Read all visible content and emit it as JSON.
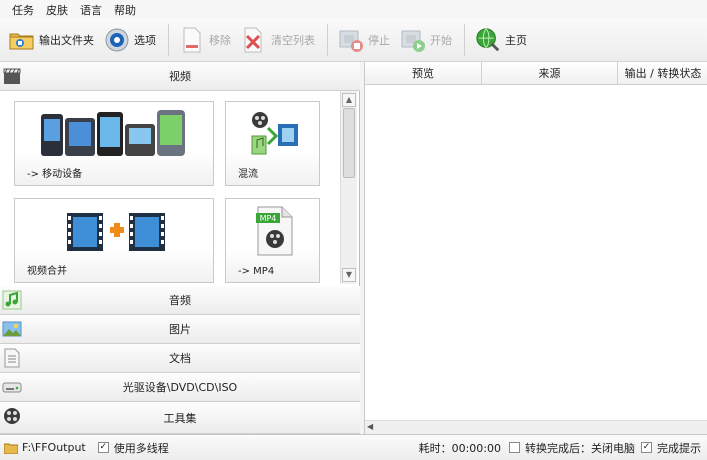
{
  "menu": [
    "任务",
    "皮肤",
    "语言",
    "帮助"
  ],
  "toolbar": {
    "output_folder": "输出文件夹",
    "options": "选项",
    "remove": "移除",
    "clear_list": "清空列表",
    "stop": "停止",
    "start": "开始",
    "home": "主页"
  },
  "left": {
    "video_header": "视频",
    "tiles": [
      "-> 移动设备",
      "混流",
      "视频合并",
      "-> MP4"
    ],
    "tile_badge_mp4": "MP4",
    "categories": [
      "音频",
      "图片",
      "文档",
      "光驱设备\\DVD\\CD\\ISO",
      "工具集"
    ]
  },
  "list": {
    "columns": [
      "预览",
      "来源",
      "输出 / 转换状态"
    ]
  },
  "status": {
    "output_path": "F:\\FFOutput",
    "multithread_label": "使用多线程",
    "multithread_checked": true,
    "elapsed": "耗时：00:00:00",
    "after_convert_label": "转换完成后：关闭电脑",
    "after_convert_checked": false,
    "no_prompt_label": "完成提示",
    "no_prompt_checked": true
  },
  "colors": {
    "accent_green": "#3aa637",
    "accent_orange": "#f08b18",
    "film_blue": "#2a6fb5"
  }
}
